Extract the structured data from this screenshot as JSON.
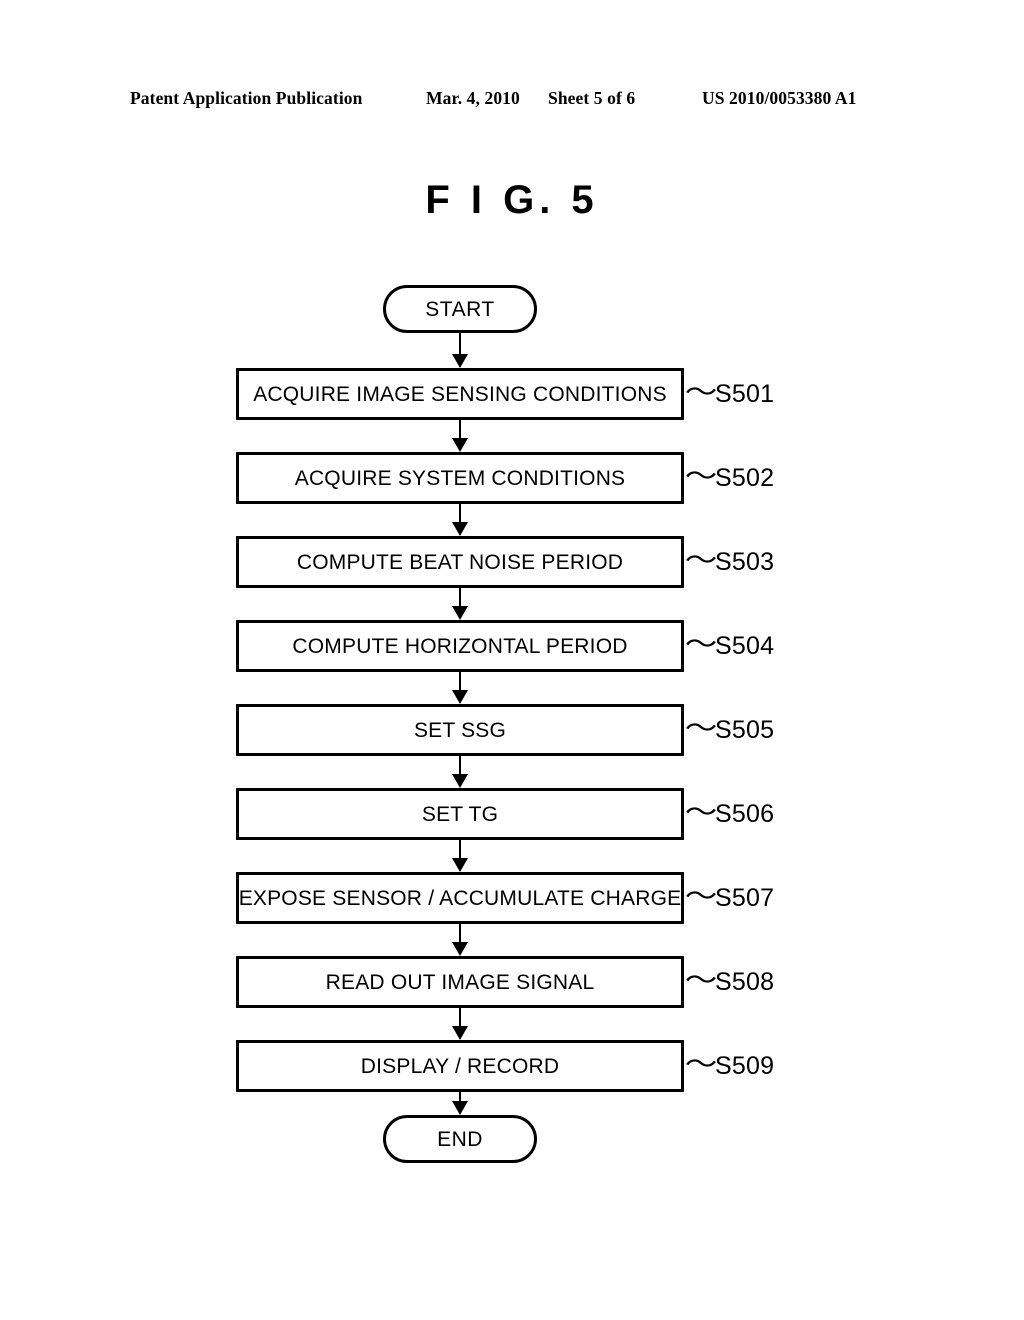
{
  "header": {
    "publication": "Patent Application Publication",
    "date": "Mar. 4, 2010",
    "sheet": "Sheet 5 of 6",
    "patent_number": "US 2010/0053380 A1"
  },
  "figure": {
    "title": "F I G.  5",
    "start_label": "START",
    "end_label": "END",
    "tilde": "〜",
    "steps": [
      {
        "text": "ACQUIRE IMAGE SENSING CONDITIONS",
        "id": "S501"
      },
      {
        "text": "ACQUIRE SYSTEM CONDITIONS",
        "id": "S502"
      },
      {
        "text": "COMPUTE BEAT NOISE PERIOD",
        "id": "S503"
      },
      {
        "text": "COMPUTE HORIZONTAL PERIOD",
        "id": "S504"
      },
      {
        "text": "SET SSG",
        "id": "S505"
      },
      {
        "text": "SET TG",
        "id": "S506"
      },
      {
        "text": "EXPOSE SENSOR / ACCUMULATE CHARGE",
        "id": "S507"
      },
      {
        "text": "READ OUT IMAGE SIGNAL",
        "id": "S508"
      },
      {
        "text": "DISPLAY / RECORD",
        "id": "S509"
      }
    ]
  }
}
